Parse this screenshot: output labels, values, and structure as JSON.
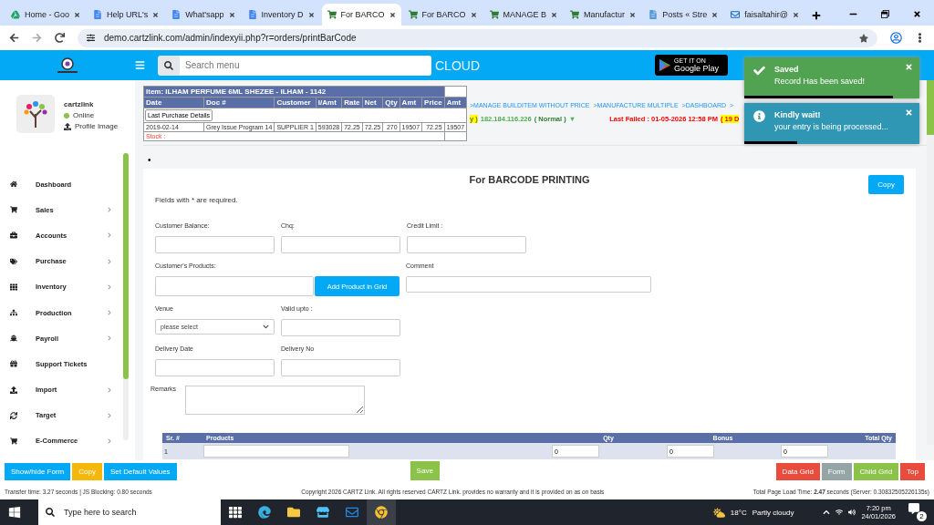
{
  "browser": {
    "tabs": [
      {
        "title": "Home - Goo",
        "selected": false
      },
      {
        "title": "Help URL's",
        "selected": false
      },
      {
        "title": "What'sapp",
        "selected": false
      },
      {
        "title": "Inventory D",
        "selected": false
      },
      {
        "title": "For BARCO",
        "selected": true
      },
      {
        "title": "For BARCO",
        "selected": false
      },
      {
        "title": "MANAGE B",
        "selected": false
      },
      {
        "title": "Manufactur",
        "selected": false
      },
      {
        "title": "Posts « Stre",
        "selected": false
      },
      {
        "title": "faisaltahir@",
        "selected": false
      }
    ],
    "address": "demo.cartzlink.com/admin/indexyii.php?r=orders/printBarCode"
  },
  "header": {
    "search": {
      "placeholder": "Search menu"
    },
    "brand": "CLOUD",
    "store_badge": {
      "small": "GET IT ON",
      "large": "Google Play"
    }
  },
  "user": {
    "name": "cartzlink",
    "status": "Online",
    "link": "Profile Image"
  },
  "sidebar": {
    "items": [
      {
        "label": "Dashboard",
        "submenu": false
      },
      {
        "label": "Sales",
        "submenu": true
      },
      {
        "label": "Accounts",
        "submenu": true
      },
      {
        "label": "Purchase",
        "submenu": true
      },
      {
        "label": "Inventory",
        "submenu": true
      },
      {
        "label": "Production",
        "submenu": true
      },
      {
        "label": "Payroll",
        "submenu": true
      },
      {
        "label": "Support Tickets",
        "submenu": false
      },
      {
        "label": "Import",
        "submenu": true
      },
      {
        "label": "Target",
        "submenu": true
      },
      {
        "label": "E-Commerce",
        "submenu": true
      }
    ]
  },
  "breadcrumbs": [
    ">MANAGE BUILDITEM WITHOUT PRICE",
    ">MANUFACTURE MULTIPLE",
    ">DASHBOARD",
    ">"
  ],
  "status_line": {
    "highlight": "y )",
    "ip": "182.184.116.226",
    "mode": "( Normal )",
    "arrow": "▼",
    "last_failed": "Last Failed : 01-05-2026 12:58 PM",
    "days": "( 19 D"
  },
  "item_popup": {
    "title": "Item: ILHAM PERFUME 6ML SHEZEE - ILHAM - 1142",
    "columns": [
      "Date",
      "Doc #",
      "Customer",
      "I/Amt",
      "Rate",
      "Net",
      "Qty",
      "Amt",
      "Price",
      "Amt"
    ],
    "button": "Last Purchase Details",
    "row": [
      "2019-02-14",
      "Grey Issue Program 14",
      "SUPPLIER 1",
      "593028",
      "72.25",
      "72.25",
      "270",
      "19507",
      "72.25",
      "19507"
    ],
    "stock": "Stock :"
  },
  "toasts": [
    {
      "kind": "success",
      "title": "Saved",
      "message": "Record Has been saved!",
      "level": 0.85
    },
    {
      "kind": "info",
      "title": "Kindly wait!",
      "message": "your entry is being processed...",
      "level": 0.3
    }
  ],
  "bullet": "•",
  "form": {
    "title": "For BARCODE PRINTING",
    "copy": "Copy",
    "required_note": "Fields with * are required.",
    "customer_balance": "Customer Balance:",
    "chq": "Chq:",
    "credit_limit": "Credit Limit :",
    "customers_products": "Customer's Products:",
    "add_product": "Add Product in Grid",
    "comment": "Comment",
    "venue": "Venue",
    "venue_value": "please select",
    "valid_upto": "Valid upto :",
    "delivery_date": "Delivery Date",
    "delivery_no": "Delivery No",
    "remarks": "Remarks"
  },
  "grid": {
    "columns": [
      "Sr. #",
      "Products",
      "Qty",
      "Bonus",
      "Total Qty"
    ],
    "rows": [
      {
        "sr": "1",
        "qty": "0",
        "bonus": "0",
        "total": "0"
      }
    ]
  },
  "actions": {
    "left": [
      "Show/hide Form",
      "Copy",
      "Set Default Values"
    ],
    "save": "Save",
    "right": [
      "Data Grid",
      "Form",
      "Child Grid",
      "Top"
    ]
  },
  "footer": {
    "transfer": "Transfer time: 3.27 seconds | JS Blocking: 0.80 seconds",
    "copyright": "Copyright 2026 CARTZ Link. All rights reserved CARTZ Link. provides no warranty and it is provided on as on basis",
    "load": "Total Page Load Time: **2.47** seconds (Server: 0.30832505226135s)"
  },
  "taskbar": {
    "search": {
      "placeholder": "Type here to search"
    },
    "temperature": "18°C",
    "weather": "Partly cloudy",
    "time": "7:20 pm",
    "date": "24/01/2026",
    "notifications": "2"
  }
}
